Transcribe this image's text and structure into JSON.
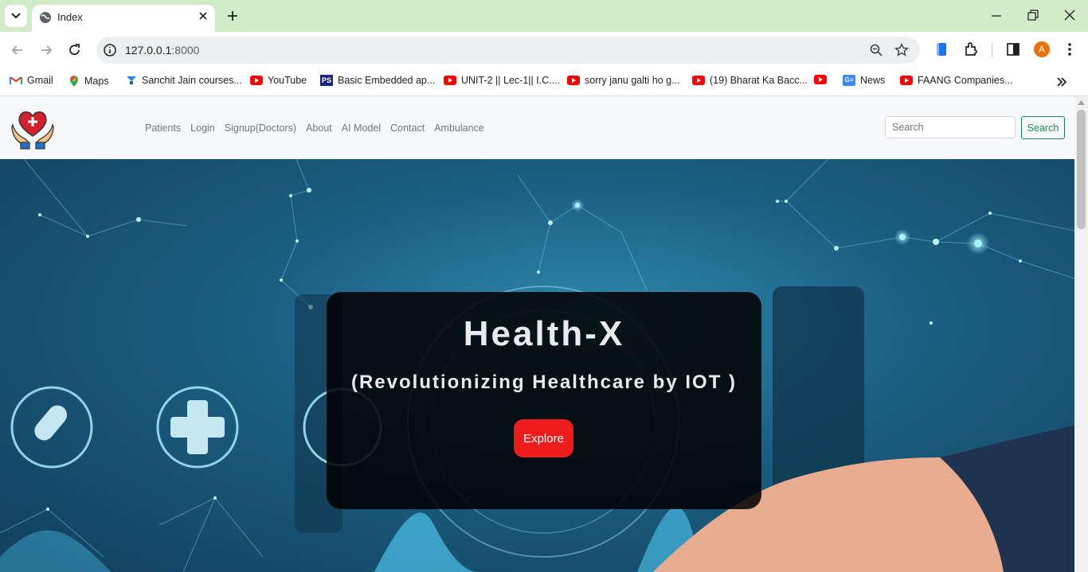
{
  "browser": {
    "tab_title": "Index",
    "url_host": "127.0.0.1",
    "url_port": ":8000",
    "profile_initial": "A",
    "bookmarks": [
      {
        "label": "Gmail",
        "icon": "gmail-icon"
      },
      {
        "label": "Maps",
        "icon": "maps-icon"
      },
      {
        "label": "Sanchit Jain courses...",
        "icon": "course-icon"
      },
      {
        "label": "YouTube",
        "icon": "youtube-icon"
      },
      {
        "label": "Basic Embedded ap...",
        "icon": "ps-icon"
      },
      {
        "label": "UNIT-2 || Lec-1|| I.C....",
        "icon": "youtube-icon"
      },
      {
        "label": "sorry janu galti ho g...",
        "icon": "youtube-icon"
      },
      {
        "label": "(19) Bharat Ka Bacc...",
        "icon": "youtube-icon"
      },
      {
        "label": "",
        "icon": "youtube-icon"
      },
      {
        "label": "News",
        "icon": "news-icon"
      },
      {
        "label": "FAANG Companies...",
        "icon": "youtube-icon"
      }
    ]
  },
  "navbar": {
    "links": [
      "Patients",
      "Login",
      "Signup(Doctors)",
      "About",
      "AI Model",
      "Contact",
      "Ambulance"
    ],
    "search_placeholder": "Search",
    "search_button": "Search"
  },
  "hero": {
    "title": "Health-X",
    "subtitle": "(Revolutionizing Healthcare by IOT )",
    "button": "Explore"
  },
  "colors": {
    "tabstrip": "#d3ecc8",
    "explore_button": "#ee1c1c",
    "search_button": "#198754",
    "hero": "#1b5f82"
  }
}
